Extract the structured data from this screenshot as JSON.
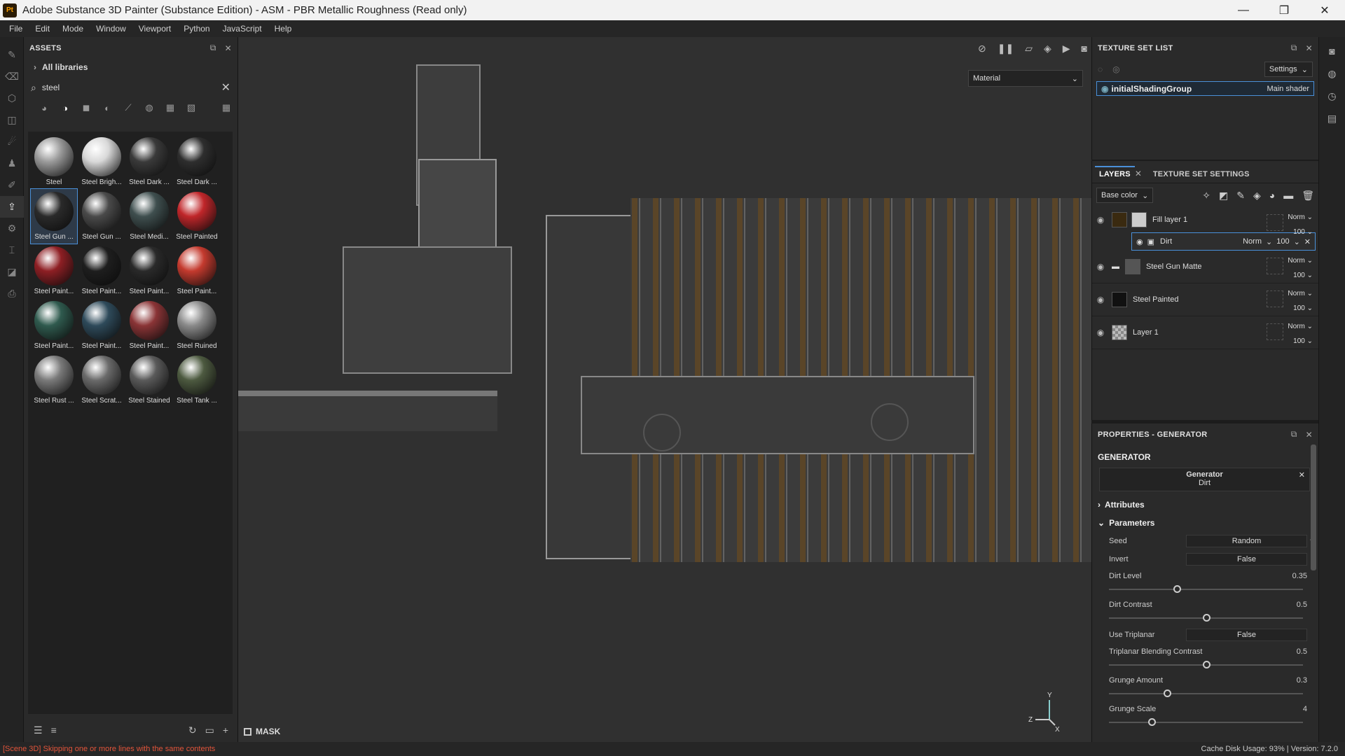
{
  "titlebar": {
    "app_icon": "Pt",
    "title": "Adobe Substance 3D Painter (Substance Edition) - ASM - PBR Metallic Roughness (Read only)",
    "minimize": "—",
    "maximize": "❐",
    "close": "✕"
  },
  "menu": [
    "File",
    "Edit",
    "Mode",
    "Window",
    "Viewport",
    "Python",
    "JavaScript",
    "Help"
  ],
  "assets": {
    "title": "ASSETS",
    "library": "All libraries",
    "search_value": "steel",
    "materials": [
      {
        "label": "Steel",
        "color": "#9a9a9a"
      },
      {
        "label": "Steel Brigh...",
        "color": "#d8d8d8"
      },
      {
        "label": "Steel Dark ...",
        "color": "#3a3a3a"
      },
      {
        "label": "Steel Dark ...",
        "color": "#2e2e2e"
      },
      {
        "label": "Steel Gun ...",
        "color": "#2a2a2a"
      },
      {
        "label": "Steel Gun ...",
        "color": "#4a4a4a"
      },
      {
        "label": "Steel Medi...",
        "color": "#3f4f4f"
      },
      {
        "label": "Steel Painted",
        "color": "#c0262a"
      },
      {
        "label": "Steel Paint...",
        "color": "#8e1f24"
      },
      {
        "label": "Steel Paint...",
        "color": "#1e1e1e"
      },
      {
        "label": "Steel Paint...",
        "color": "#2a2a2a"
      },
      {
        "label": "Steel Paint...",
        "color": "#c43a2e"
      },
      {
        "label": "Steel Paint...",
        "color": "#2f5a4e"
      },
      {
        "label": "Steel Paint...",
        "color": "#2e4a5a"
      },
      {
        "label": "Steel Paint...",
        "color": "#8a3436"
      },
      {
        "label": "Steel Ruined",
        "color": "#8a8a8a"
      },
      {
        "label": "Steel Rust ...",
        "color": "#7a7a7a"
      },
      {
        "label": "Steel Scrat...",
        "color": "#6a6a6a"
      },
      {
        "label": "Steel Stained",
        "color": "#5a5a5a"
      },
      {
        "label": "Steel Tank ...",
        "color": "#4d5a40"
      }
    ]
  },
  "viewport": {
    "material_mode": "Material",
    "mask_label": "MASK"
  },
  "texture_set_list": {
    "title": "TEXTURE SET LIST",
    "settings": "Settings",
    "shading_group": "initialShadingGroup",
    "shader": "Main shader"
  },
  "layers": {
    "tabs": [
      "LAYERS",
      "TEXTURE SET SETTINGS"
    ],
    "channel": "Base color",
    "items": [
      {
        "name": "Fill layer 1",
        "blend": "Norm",
        "opacity": "100"
      },
      {
        "name": "Steel Gun Matte",
        "blend": "Norm",
        "opacity": "100"
      },
      {
        "name": "Steel Painted",
        "blend": "Norm",
        "opacity": "100"
      },
      {
        "name": "Layer 1",
        "blend": "Norm",
        "opacity": "100"
      }
    ],
    "sub_effect": {
      "name": "Dirt",
      "blend": "Norm",
      "opacity": "100"
    }
  },
  "properties": {
    "title": "PROPERTIES - GENERATOR",
    "section": "GENERATOR",
    "generator_label": "Generator",
    "generator_value": "Dirt",
    "attributes": "Attributes",
    "parameters": "Parameters",
    "seed": {
      "label": "Seed",
      "value": "Random"
    },
    "invert": {
      "label": "Invert",
      "value": "False"
    },
    "use_triplanar": {
      "label": "Use Triplanar",
      "value": "False"
    },
    "sliders": [
      {
        "label": "Dirt Level",
        "value": "0.35",
        "fraction": 0.35
      },
      {
        "label": "Dirt Contrast",
        "value": "0.5",
        "fraction": 0.5
      },
      {
        "label": "Triplanar Blending Contrast",
        "value": "0.5",
        "fraction": 0.5
      },
      {
        "label": "Grunge Amount",
        "value": "0.3",
        "fraction": 0.3
      },
      {
        "label": "Grunge Scale",
        "value": "4",
        "fraction": 0.22
      }
    ]
  },
  "status": {
    "message": "[Scene 3D] Skipping one or more lines with the same contents",
    "cache": "Cache Disk Usage:    93% | Version: 7.2.0"
  }
}
